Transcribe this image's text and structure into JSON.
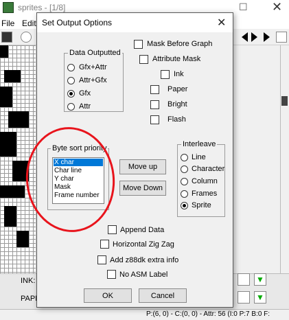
{
  "app": {
    "title": "sprites - [1/8]",
    "menu": [
      "File",
      "Edit"
    ],
    "bottom": {
      "ink_label": "INK:",
      "paper_label": "PAPE"
    },
    "status": "P:(6, 0) - C:(0, 0) - Attr: 56 (I:0 P:7 B:0 F:"
  },
  "dialog": {
    "title": "Set Output Options",
    "close_glyph": "✕",
    "mask_before_graph": {
      "label": "Mask Before Graph",
      "checked": false
    },
    "attribute_mask": {
      "label": "Attribute Mask",
      "checked": false
    },
    "ink": {
      "label": "Ink",
      "checked": false
    },
    "paper": {
      "label": "Paper",
      "checked": false
    },
    "bright": {
      "label": "Bright",
      "checked": false
    },
    "flash": {
      "label": "Flash",
      "checked": false
    },
    "data_outputted": {
      "title": "Data Outputted",
      "options": [
        "Gfx+Attr",
        "Attr+Gfx",
        "Gfx",
        "Attr"
      ],
      "selected": "Gfx"
    },
    "byte_sort": {
      "title": "Byte sort priority",
      "items": [
        "X char",
        "Char line",
        "Y char",
        "Mask",
        "Frame number"
      ],
      "selected": "X char"
    },
    "move_up": "Move up",
    "move_down": "Move Down",
    "interleave": {
      "title": "Interleave",
      "options": [
        "Line",
        "Character",
        "Column",
        "Frames",
        "Sprite"
      ],
      "selected": "Sprite"
    },
    "append_data": {
      "label": "Append Data",
      "checked": false
    },
    "horizontal_zigzag": {
      "label": "Horizontal Zig Zag",
      "checked": false
    },
    "z88dk": {
      "label": "Add z88dk extra info",
      "checked": false
    },
    "no_asm_label": {
      "label": "No ASM Label",
      "checked": false
    },
    "ok": "OK",
    "cancel": "Cancel"
  },
  "colors": {
    "annotation": "#e8141c",
    "selection": "#0078d7"
  }
}
